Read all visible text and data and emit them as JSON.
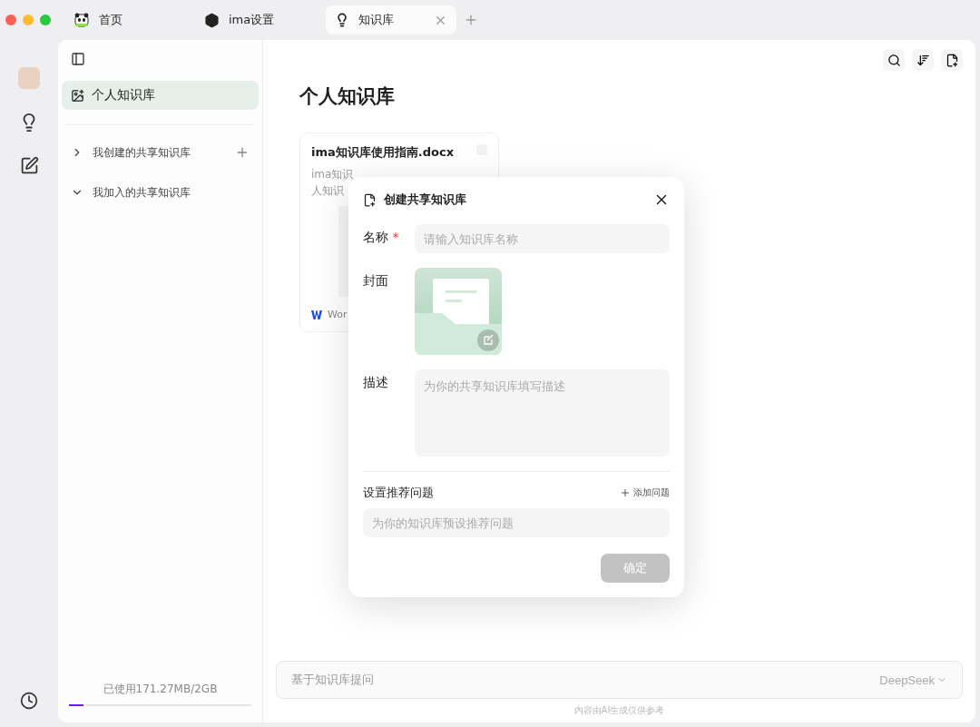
{
  "tabs": [
    {
      "label": "首页",
      "selected": false
    },
    {
      "label": "ima设置",
      "selected": false
    },
    {
      "label": "知识库",
      "selected": true
    }
  ],
  "sidebar": {
    "items": [
      {
        "label": "个人知识库",
        "selected": true
      }
    ],
    "groups": [
      {
        "label": "我创建的共享知识库",
        "expanded": false,
        "addable": true
      },
      {
        "label": "我加入的共享知识库",
        "expanded": true,
        "addable": false
      }
    ],
    "storage": {
      "reading": "已使用171.27MB/2GB",
      "level": 0.08
    }
  },
  "page": {
    "title": "个人知识库",
    "cards": [
      {
        "title": "ima知识库使用指南.docx",
        "excerpt": [
          "ima知识",
          "人知识"
        ],
        "source": "Wor"
      }
    ],
    "ask": {
      "placeholder": "基于知识库提问",
      "model": "DeepSeek",
      "note": "内容由AI生成仅供参考"
    }
  },
  "dialog": {
    "title": "创建共享知识库",
    "name": {
      "label": "名称",
      "required_mark": "*",
      "placeholder": "请输入知识库名称"
    },
    "cover": {
      "label": "封面"
    },
    "description": {
      "label": "描述",
      "placeholder": "为你的共享知识库填写描述"
    },
    "questions": {
      "label": "设置推荐问题",
      "add": "添加问题",
      "placeholder": "为你的知识库预设推荐问题"
    },
    "confirm": {
      "label": "确定",
      "disabled": true
    }
  }
}
